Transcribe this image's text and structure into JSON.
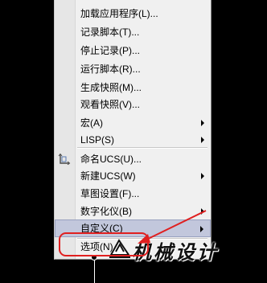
{
  "menu": {
    "items": [
      {
        "label": "加载应用程序(L)...",
        "submenu": false
      },
      {
        "label": "记录脚本(T)...",
        "submenu": false
      },
      {
        "label": "停止记录(P)...",
        "submenu": false
      },
      {
        "label": "运行脚本(R)...",
        "submenu": false
      },
      {
        "label": "生成快照(M)...",
        "submenu": false
      },
      {
        "label": "观看快照(V)...",
        "submenu": false
      },
      {
        "label": "宏(A)",
        "submenu": true
      },
      {
        "label": "LISP(S)",
        "submenu": true
      },
      {
        "label": "命名UCS(U)...",
        "submenu": false,
        "icon": "ucs-icon"
      },
      {
        "label": "新建UCS(W)",
        "submenu": true
      },
      {
        "label": "草图设置(F)...",
        "submenu": false
      },
      {
        "label": "数字化仪(B)",
        "submenu": true
      },
      {
        "label": "自定义(C)",
        "submenu": true,
        "highlighted": true
      },
      {
        "label": "选项(N)...",
        "submenu": false
      }
    ]
  },
  "annotation": {
    "color": "#e02020"
  },
  "watermark": {
    "text": "机械设计"
  },
  "colors": {
    "background": "#000000",
    "menu": "#f0f0f0",
    "highlight": "#c2c7dc"
  }
}
